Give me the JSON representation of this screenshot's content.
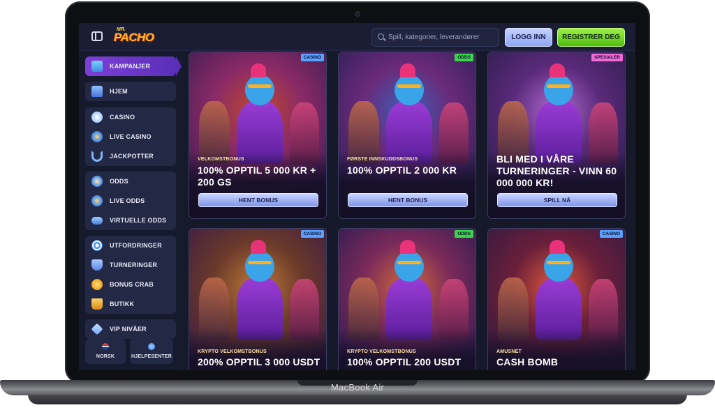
{
  "device": {
    "label": "MacBook Air"
  },
  "header": {
    "logo_small": "MR.",
    "logo_main": "PACHO",
    "search_placeholder": "Spill, kategorier, leverandører",
    "login_label": "LOGG INN",
    "register_label": "REGISTRER DEG"
  },
  "sidebar": {
    "groups": [
      {
        "items": [
          {
            "label": "KAMPANJER",
            "icon": "gift-icon",
            "active": true
          }
        ]
      },
      {
        "items": [
          {
            "label": "HJEM",
            "icon": "home-icon"
          }
        ]
      },
      {
        "items": [
          {
            "label": "CASINO",
            "icon": "cards-icon"
          },
          {
            "label": "LIVE CASINO",
            "icon": "globe-icon"
          },
          {
            "label": "JACKPOTTER",
            "icon": "horseshoe-icon"
          }
        ]
      },
      {
        "items": [
          {
            "label": "ODDS",
            "icon": "ball-icon"
          },
          {
            "label": "LIVE ODDS",
            "icon": "live-ball-icon"
          },
          {
            "label": "VIRTUELLE ODDS",
            "icon": "gamepad-icon"
          }
        ]
      },
      {
        "items": [
          {
            "label": "UTFORDRINGER",
            "icon": "target-icon"
          },
          {
            "label": "TURNERINGER",
            "icon": "trophy-icon"
          },
          {
            "label": "BONUS CRAB",
            "icon": "crab-icon"
          },
          {
            "label": "BUTIKK",
            "icon": "basket-icon"
          }
        ]
      },
      {
        "items": [
          {
            "label": "VIP NIVÅER",
            "icon": "diamond-icon"
          }
        ]
      }
    ],
    "language_label": "NORSK",
    "help_label": "HJELPESENTER"
  },
  "cards": [
    {
      "badge": "CASINO",
      "badge_type": "casino",
      "subtitle": "VELKOMSTBONUS",
      "title": "100% OPPTIL 5 000 KR + 200 GS",
      "button": "HENT BONUS"
    },
    {
      "badge": "ODDS",
      "badge_type": "odds",
      "subtitle": "FØRSTE INNSKUDDSBONUS",
      "title": "100% OPPTIL 2 000 KR",
      "button": "HENT BONUS"
    },
    {
      "badge": "SPESIALER",
      "badge_type": "spec",
      "subtitle": "",
      "title": "BLI MED I VÅRE TURNERINGER - VINN 60 000 000 KR!",
      "button": "SPILL NÅ"
    },
    {
      "badge": "CASINO",
      "badge_type": "casino",
      "subtitle": "KRYPTO VELKOMSTBONUS",
      "title": "200% OPPTIL 3 000 USDT",
      "button": ""
    },
    {
      "badge": "ODDS",
      "badge_type": "odds",
      "subtitle": "KRYPTO VELKOMSTBONUS",
      "title": "100% OPPTIL 200 USDT",
      "button": ""
    },
    {
      "badge": "CASINO",
      "badge_type": "casino",
      "subtitle": "AMUSNET",
      "title": "CASH BOMB",
      "button": ""
    }
  ],
  "colors": {
    "accent_purple": "#7e3fd8",
    "login_blue": "#8da6f3",
    "register_green": "#4ebc12",
    "badge_casino": "#5aa0ff",
    "badge_odds": "#39d64a",
    "badge_special": "#f06bd6"
  }
}
